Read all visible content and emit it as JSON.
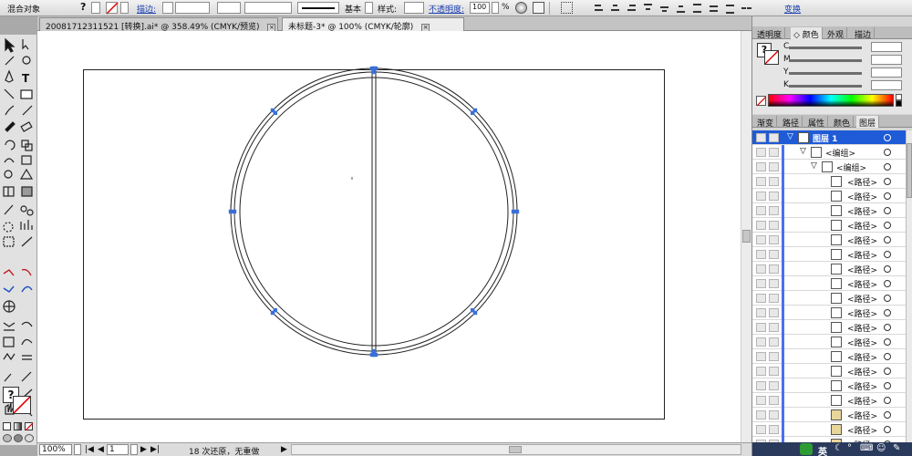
{
  "control_bar": {
    "object_type": "混合对象",
    "help_glyph": "?",
    "stroke_label": "描边:",
    "stroke_style_label": "基本",
    "style_label": "样式:",
    "opacity_label": "不透明度:",
    "opacity_value": "100",
    "opacity_unit": "%",
    "transform_label": "变换",
    "accent_color": "#1a3fb0"
  },
  "doc_tabs": [
    {
      "label": "20081712311521 [转换].ai* @ 358.49% (CMYK/预览)",
      "active": false
    },
    {
      "label": "未标题-3* @ 100% (CMYK/轮廓)",
      "active": true
    }
  ],
  "tools": [
    "selection-icon",
    "direct-selection-icon",
    "magic-wand-icon",
    "lasso-icon",
    "pen-icon",
    "type-icon",
    "line-segment-icon",
    "rectangle-icon",
    "paintbrush-icon",
    "pencil-icon",
    "blob-brush-icon",
    "eraser-icon",
    "rotate-icon",
    "scale-icon",
    "width-icon",
    "free-transform-icon",
    "shape-builder-icon",
    "perspective-grid-icon",
    "mesh-icon",
    "gradient-icon",
    "eyedropper-icon",
    "blend-icon",
    "symbol-sprayer-icon",
    "column-graph-icon",
    "artboard-icon",
    "slice-icon",
    "hand-icon",
    "zoom-icon"
  ],
  "canvas": {
    "handle_color": "#3b6fd8"
  },
  "status_bar": {
    "zoom": "100%",
    "artboard": "1",
    "history": "18 次还原，无重做"
  },
  "color_panel": {
    "tabs": [
      "透明度",
      "颜色",
      "外观",
      "描边"
    ],
    "active_tab": 1,
    "channels": [
      "C",
      "M",
      "Y",
      "K"
    ]
  },
  "layers_panel": {
    "tabs": [
      "渐变",
      "路径",
      "属性",
      "颜色",
      "图层"
    ],
    "active_tab": 4,
    "layer_name": "图层 1",
    "group_name": "<编组>",
    "subgroup_name": "<编组>",
    "path_name": "<路径>",
    "path_rows": 19,
    "selection_color": "#1f5bd6"
  },
  "taskbar": {
    "ime_label": "英"
  }
}
